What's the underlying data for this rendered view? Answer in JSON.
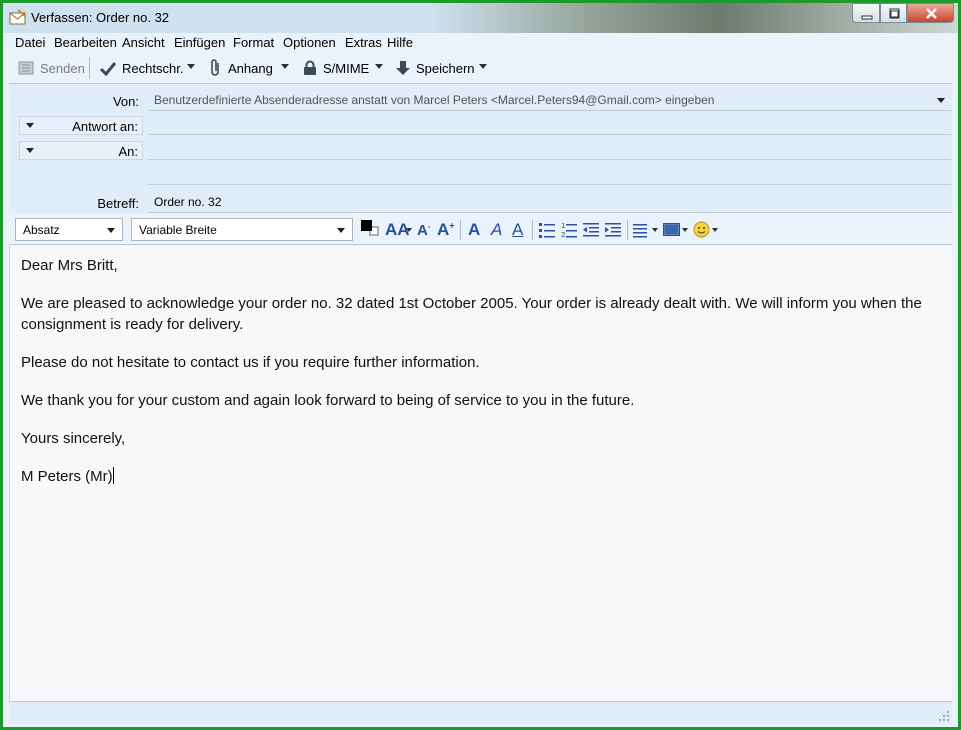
{
  "window": {
    "title": "Verfassen: Order no. 32"
  },
  "menu": [
    "Datei",
    "Bearbeiten",
    "Ansicht",
    "Einfügen",
    "Format",
    "Optionen",
    "Extras",
    "Hilfe"
  ],
  "toolbar": {
    "send_label": "Senden",
    "spell_label": "Rechtschr.",
    "attach_label": "Anhang",
    "smime_label": "S/MIME",
    "save_label": "Speichern"
  },
  "header": {
    "from_label": "Von:",
    "from_value": "Benutzerdefinierte Absenderadresse anstatt von Marcel Peters <Marcel.Peters94@Gmail.com> eingeben",
    "replyto_label": "Antwort an:",
    "to_label": "An:",
    "subject_label": "Betreff:",
    "subject_value": "Order no. 32"
  },
  "format": {
    "paragraph_style": "Absatz",
    "font": "Variable Breite",
    "text_color": "#000000"
  },
  "body": {
    "greeting": "Dear Mrs Britt,",
    "paragraph1": "We are pleased to acknowledge your order no. 32 dated 1st October 2005. Your order is already dealt with. We will inform you when the consignment is ready for delivery.",
    "paragraph2": "Please do not hesitate to contact us if you require further information.",
    "paragraph3": "We thank you for your custom and again look forward to being of service to you in the future.",
    "closing": "Yours sincerely,",
    "signature": "M Peters (Mr)"
  },
  "colors": {
    "window_border": "#1e9a2c",
    "header_bg": "#e0ecf8",
    "body_bg": "#f8f7fa",
    "format_icon": "#2a4f9b"
  }
}
